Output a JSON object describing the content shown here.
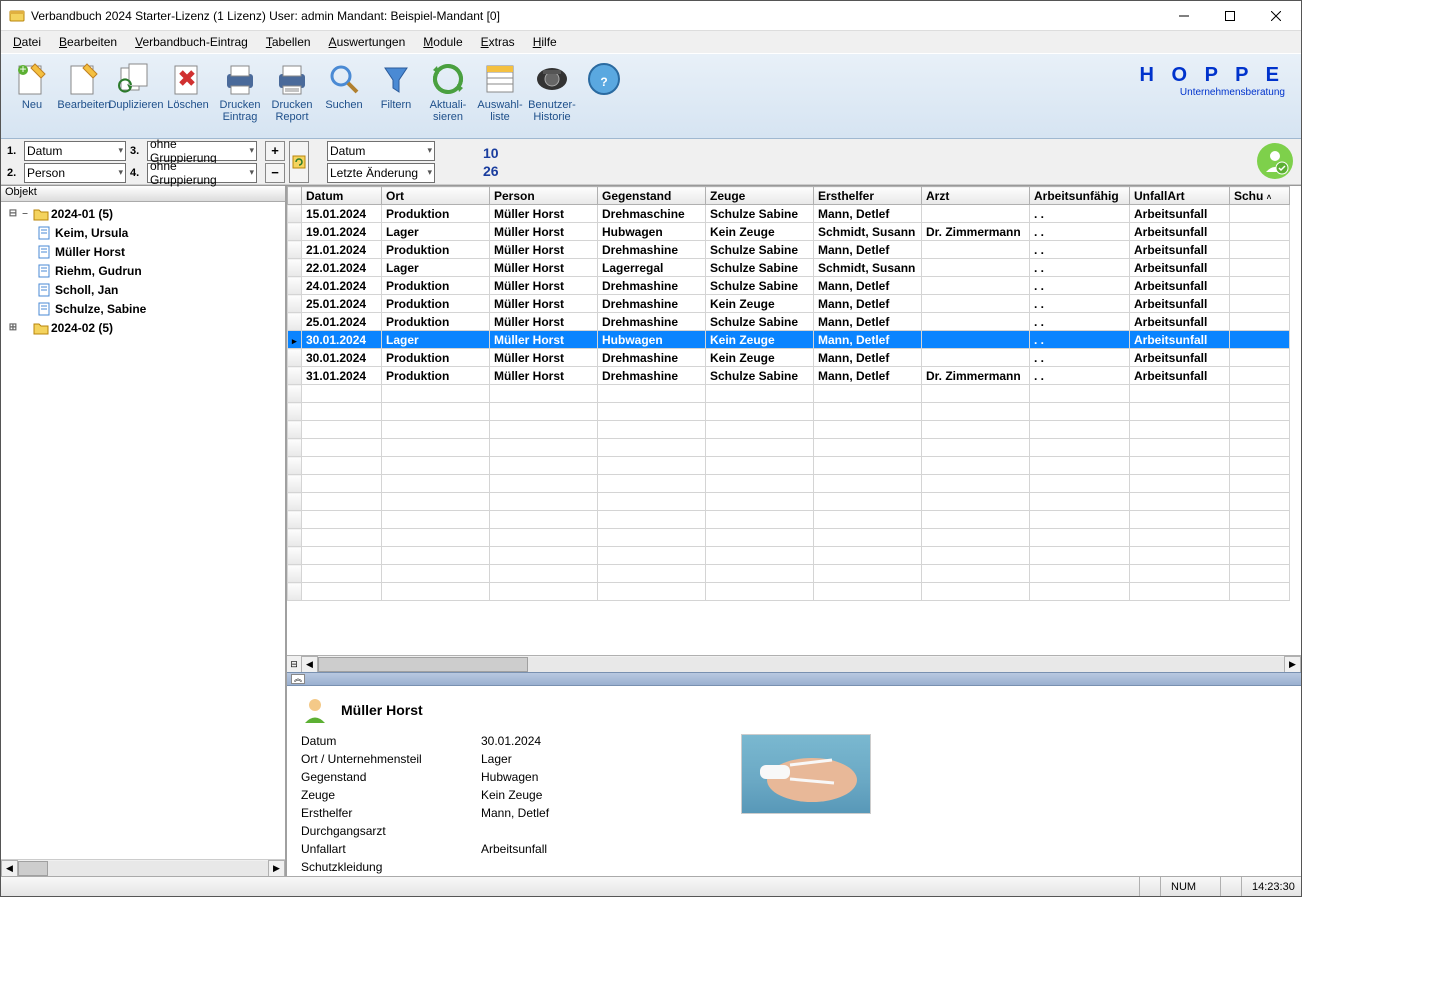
{
  "window": {
    "title": "Verbandbuch 2024 Starter-Lizenz (1 Lizenz)   User: admin Mandant: Beispiel-Mandant [0]"
  },
  "menu": [
    "Datei",
    "Bearbeiten",
    "Verbandbuch-Eintrag",
    "Tabellen",
    "Auswertungen",
    "Module",
    "Extras",
    "Hilfe"
  ],
  "toolbar": [
    {
      "id": "neu",
      "label": "Neu"
    },
    {
      "id": "bearbeiten",
      "label": "Bearbeiten"
    },
    {
      "id": "duplizieren",
      "label": "Duplizieren"
    },
    {
      "id": "loeschen",
      "label": "Löschen"
    },
    {
      "id": "drucken-eintrag",
      "label": "Drucken\nEintrag"
    },
    {
      "id": "drucken-report",
      "label": "Drucken\nReport"
    },
    {
      "id": "suchen",
      "label": "Suchen"
    },
    {
      "id": "filtern",
      "label": "Filtern"
    },
    {
      "id": "aktualisieren",
      "label": "Aktuali-\nsieren"
    },
    {
      "id": "auswahlliste",
      "label": "Auswahl-\nliste"
    },
    {
      "id": "benutzer-historie",
      "label": "Benutzer-\nHistorie"
    },
    {
      "id": "hilfe",
      "label": ""
    }
  ],
  "brand": {
    "name": "H O P P E",
    "sub": "Unternehmensberatung"
  },
  "filters": {
    "g1": {
      "label": "1.",
      "value": "Datum"
    },
    "g2": {
      "label": "2.",
      "value": "Person"
    },
    "g3": {
      "label": "3.",
      "value": "ohne Gruppierung"
    },
    "g4": {
      "label": "4.",
      "value": "ohne Gruppierung"
    },
    "sort1": "Datum",
    "sort2": "Letzte Änderung",
    "count1": "10",
    "count2": "26"
  },
  "sidebar": {
    "header": "Objekt",
    "nodes": [
      {
        "type": "folder",
        "expanded": true,
        "label": "2024-01  (5)",
        "children": [
          {
            "label": "Keim, Ursula"
          },
          {
            "label": "Müller Horst"
          },
          {
            "label": "Riehm, Gudrun"
          },
          {
            "label": "Scholl, Jan"
          },
          {
            "label": "Schulze, Sabine"
          }
        ]
      },
      {
        "type": "folder",
        "expanded": false,
        "label": "2024-02  (5)"
      }
    ]
  },
  "grid": {
    "cols": [
      "Datum",
      "Ort",
      "Person",
      "Gegenstand",
      "Zeuge",
      "Ersthelfer",
      "Arzt",
      "Arbeitsunfähig",
      "UnfallArt",
      "Schu"
    ],
    "rows": [
      {
        "d": "15.01.2024",
        "o": "Produktion",
        "p": "Müller Horst",
        "g": "Drehmaschine",
        "z": "Schulze Sabine",
        "e": "Mann, Detlef",
        "a": "",
        "au": "  .  .",
        "ua": "Arbeitsunfall"
      },
      {
        "d": "19.01.2024",
        "o": "Lager",
        "p": "Müller Horst",
        "g": "Hubwagen",
        "z": "Kein Zeuge",
        "e": "Schmidt, Susann",
        "a": "Dr. Zimmermann",
        "au": "  .  .",
        "ua": "Arbeitsunfall"
      },
      {
        "d": "21.01.2024",
        "o": "Produktion",
        "p": "Müller Horst",
        "g": "Drehmashine",
        "z": "Schulze Sabine",
        "e": "Mann, Detlef",
        "a": "",
        "au": "  .  .",
        "ua": "Arbeitsunfall"
      },
      {
        "d": "22.01.2024",
        "o": "Lager",
        "p": "Müller Horst",
        "g": "Lagerregal",
        "z": "Schulze Sabine",
        "e": "Schmidt, Susann",
        "a": "",
        "au": "  .  .",
        "ua": "Arbeitsunfall"
      },
      {
        "d": "24.01.2024",
        "o": "Produktion",
        "p": "Müller Horst",
        "g": "Drehmashine",
        "z": "Schulze Sabine",
        "e": "Mann, Detlef",
        "a": "",
        "au": "  .  .",
        "ua": "Arbeitsunfall"
      },
      {
        "d": "25.01.2024",
        "o": "Produktion",
        "p": "Müller Horst",
        "g": "Drehmashine",
        "z": "Kein Zeuge",
        "e": "Mann, Detlef",
        "a": "",
        "au": "  .  .",
        "ua": "Arbeitsunfall"
      },
      {
        "d": "25.01.2024",
        "o": "Produktion",
        "p": "Müller Horst",
        "g": "Drehmashine",
        "z": "Schulze Sabine",
        "e": "Mann, Detlef",
        "a": "",
        "au": "  .  .",
        "ua": "Arbeitsunfall"
      },
      {
        "d": "30.01.2024",
        "o": "Lager",
        "p": "Müller Horst",
        "g": "Hubwagen",
        "z": "Kein Zeuge",
        "e": "Mann, Detlef",
        "a": "",
        "au": "  .  .",
        "ua": "Arbeitsunfall",
        "sel": true
      },
      {
        "d": "30.01.2024",
        "o": "Produktion",
        "p": "Müller Horst",
        "g": "Drehmashine",
        "z": "Kein Zeuge",
        "e": "Mann, Detlef",
        "a": "",
        "au": "  .  .",
        "ua": "Arbeitsunfall"
      },
      {
        "d": "31.01.2024",
        "o": "Produktion",
        "p": "Müller Horst",
        "g": "Drehmashine",
        "z": "Schulze Sabine",
        "e": "Mann, Detlef",
        "a": "Dr. Zimmermann",
        "au": "  .  .",
        "ua": "Arbeitsunfall"
      }
    ]
  },
  "detail": {
    "name": "Müller Horst",
    "fields": [
      [
        "Datum",
        "30.01.2024"
      ],
      [
        "Ort / Unternehmensteil",
        "Lager"
      ],
      [
        "Gegenstand",
        "Hubwagen"
      ],
      [
        "Zeuge",
        "Kein Zeuge"
      ],
      [
        "Ersthelfer",
        "Mann, Detlef"
      ],
      [
        "Durchgangsarzt",
        ""
      ],
      [
        "Unfallart",
        "Arbeitsunfall"
      ],
      [
        "Schutzkleidung",
        ""
      ]
    ]
  },
  "status": {
    "num": "NUM",
    "time": "14:23:30"
  }
}
